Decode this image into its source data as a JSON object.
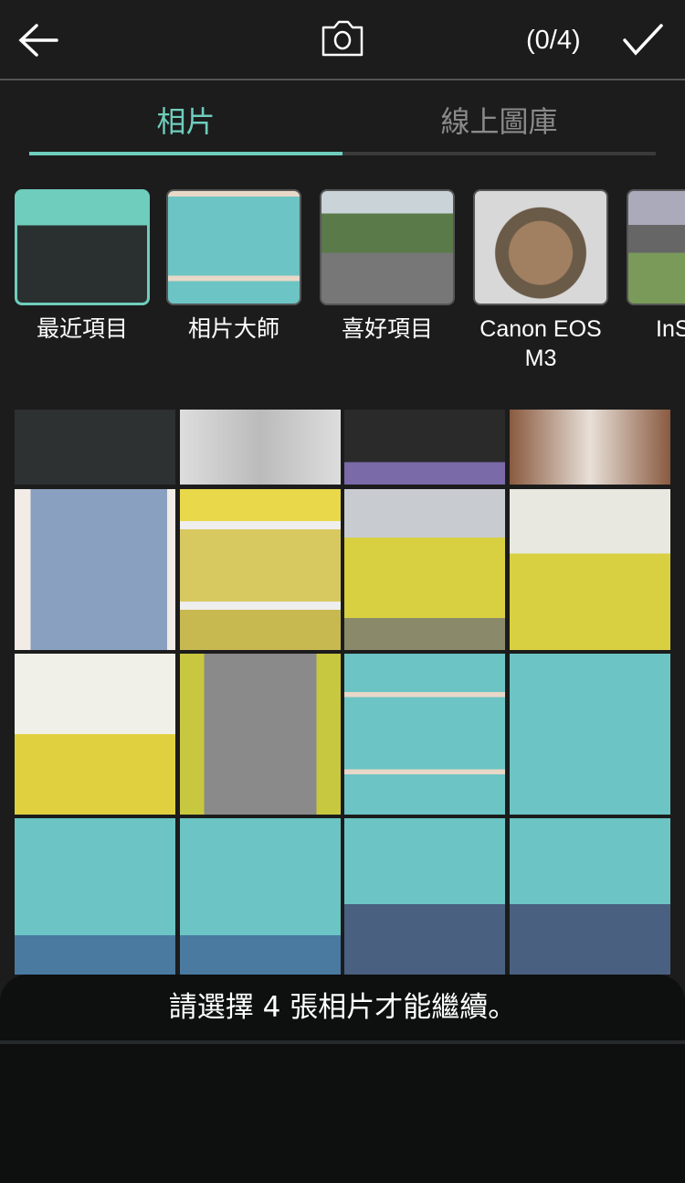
{
  "header": {
    "selection_count": "(0/4)"
  },
  "tabs": [
    {
      "label": "相片",
      "active": true
    },
    {
      "label": "線上圖庫",
      "active": false
    }
  ],
  "albums": [
    {
      "label": "最近項目"
    },
    {
      "label": "相片大師"
    },
    {
      "label": "喜好項目"
    },
    {
      "label": "Canon EOS M3"
    },
    {
      "label": "InS"
    }
  ],
  "colors": {
    "accent": "#6fcdbd"
  },
  "toast": {
    "message": "請選擇 4 張相片才能繼續。"
  }
}
